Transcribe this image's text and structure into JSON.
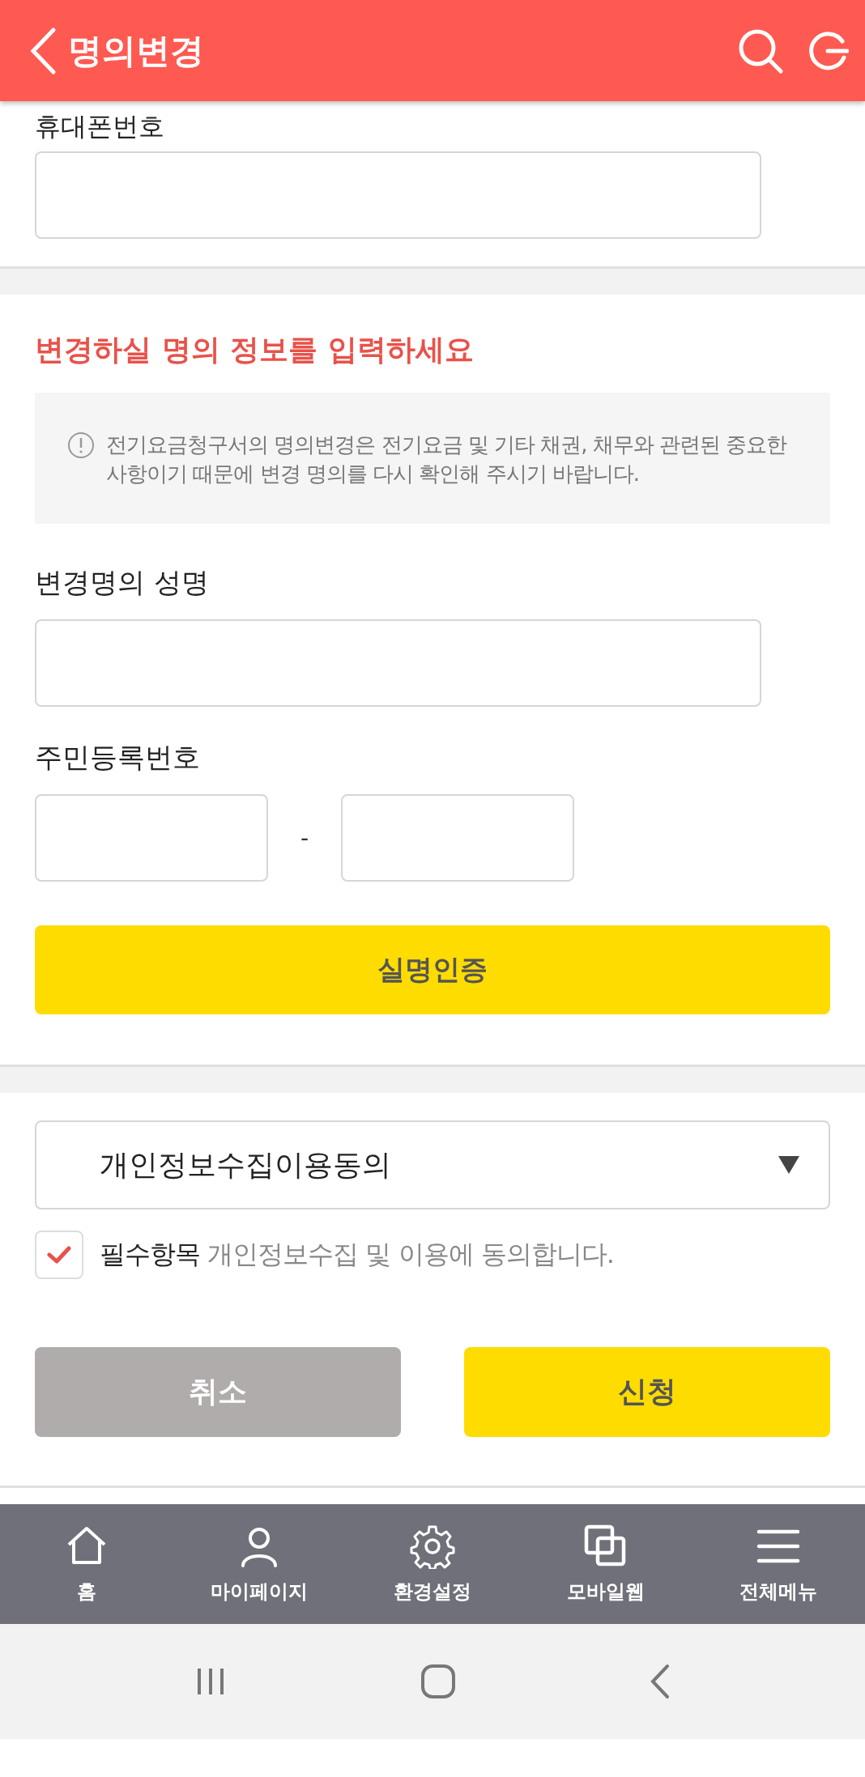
{
  "header": {
    "title": "명의변경"
  },
  "phone": {
    "label": "휴대폰번호"
  },
  "form": {
    "title": "변경하실 명의 정보를 입력하세요",
    "notice": "전기요금청구서의 명의변경은 전기요금 및 기타 채권, 채무와 관련된 중요한 사항이기 때문에 변경 명의를 다시 확인해 주시기 바랍니다.",
    "name_label": "변경명의 성명",
    "id_label": "주민등록번호",
    "id_separator": "-",
    "verify_button": "실명인증"
  },
  "consent": {
    "select": "개인정보수집이용동의",
    "checked": true,
    "required": "필수항목",
    "text": "개인정보수집 및 이용에 동의합니다."
  },
  "buttons": [
    {
      "label": "취소",
      "kind": "cancel"
    },
    {
      "label": "신청",
      "kind": "submit"
    }
  ],
  "nav": [
    {
      "label": "홈",
      "kind": "home"
    },
    {
      "label": "마이페이지",
      "kind": "person"
    },
    {
      "label": "환경설정",
      "kind": "gear"
    },
    {
      "label": "모바일웹",
      "kind": "windows"
    },
    {
      "label": "전체메뉴",
      "kind": "menu"
    }
  ]
}
